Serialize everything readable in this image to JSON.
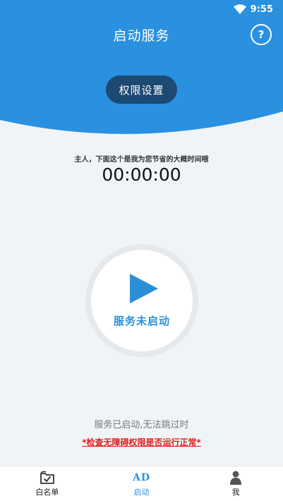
{
  "status_bar": {
    "time": "9:55",
    "icons": [
      "wifi-icon"
    ]
  },
  "header": {
    "title": "启动服务",
    "help_label": "?",
    "permission_button": "权限设置"
  },
  "main": {
    "saved_time_caption": "主人，下面这个是我为您节省的大概时间哦",
    "saved_time": "00:00:00",
    "start_button": {
      "label": "服务未启动",
      "icon": "play-icon"
    },
    "service_message": "服务已启动,无法跳过时",
    "check_link": "*检查无障碍权限是否运行正常*"
  },
  "bottom_nav": {
    "active_index": 1,
    "items": [
      {
        "label": "白名单",
        "icon": "folder-check-icon"
      },
      {
        "label": "启动",
        "icon": "ad-icon",
        "icon_text": "AD"
      },
      {
        "label": "我",
        "icon": "person-icon"
      }
    ]
  },
  "colors": {
    "primary": "#2b8fd8",
    "header_blue": "#2a90e0",
    "button_dark": "#1c4a72",
    "warning_red": "#e02020",
    "background": "#f0f4f7"
  }
}
